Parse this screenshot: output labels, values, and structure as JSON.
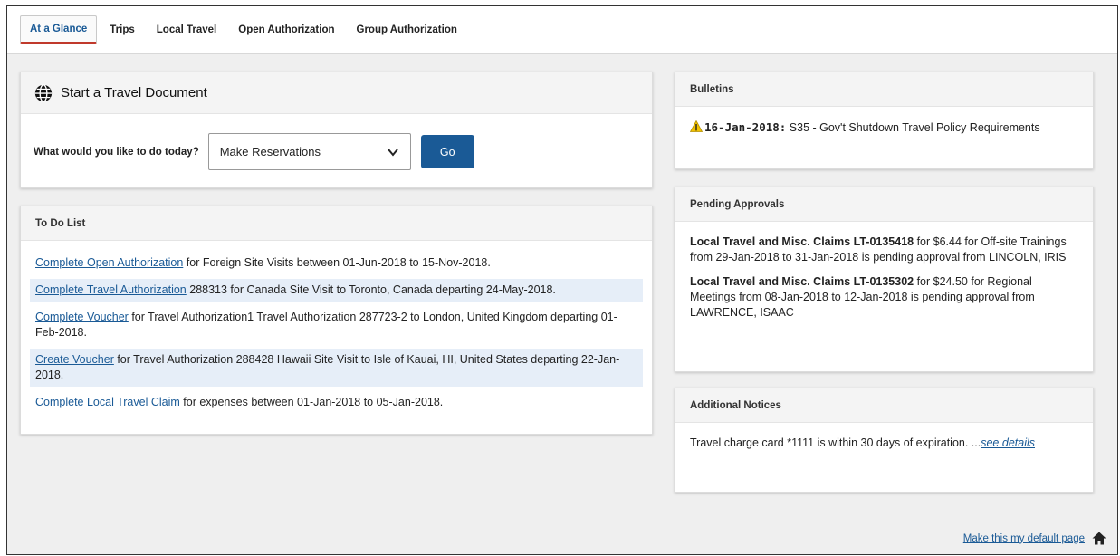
{
  "tabs": [
    "At a Glance",
    "Trips",
    "Local Travel",
    "Open Authorization",
    "Group Authorization"
  ],
  "start": {
    "title": "Start a Travel Document",
    "question": "What would you like to do today?",
    "selected": "Make Reservations",
    "go_label": "Go"
  },
  "todo": {
    "title": "To Do List",
    "items": [
      {
        "link": "Complete Open Authorization",
        "text": " for Foreign Site Visits between 01-Jun-2018 to 15-Nov-2018."
      },
      {
        "link": "Complete Travel Authorization",
        "text": " 288313 for Canada Site Visit to Toronto, Canada departing 24-May-2018."
      },
      {
        "link": "Complete Voucher",
        "text": " for Travel Authorization1 Travel Authorization 287723-2 to London, United Kingdom departing 01-Feb-2018."
      },
      {
        "link": "Create Voucher",
        "text": " for Travel Authorization 288428 Hawaii Site Visit to Isle of Kauai, HI, United States departing 22-Jan-2018."
      },
      {
        "link": "Complete Local Travel Claim",
        "text": " for expenses between 01-Jan-2018 to 05-Jan-2018."
      }
    ]
  },
  "bulletins": {
    "title": "Bulletins",
    "date": "16-Jan-2018:",
    "text": " S35 - Gov't Shutdown Travel Policy Requirements"
  },
  "approvals": {
    "title": "Pending Approvals",
    "items": [
      {
        "bold": "Local Travel and Misc. Claims LT-0135418",
        "text": " for $6.44 for Off-site Trainings from 29-Jan-2018 to 31-Jan-2018 is pending approval from LINCOLN, IRIS"
      },
      {
        "bold": "Local Travel and Misc. Claims LT-0135302",
        "text": " for $24.50 for Regional Meetings from 08-Jan-2018 to 12-Jan-2018 is pending approval from LAWRENCE, ISAAC"
      }
    ]
  },
  "notices": {
    "title": "Additional Notices",
    "text": "Travel charge card *1111 is within 30 days of expiration. ...",
    "link": "see details"
  },
  "footer": {
    "default_link": "Make this my default page"
  },
  "colors": {
    "accent": "#1a5a96",
    "active_tab_underline": "#c0392b",
    "warning": "#f2c200"
  },
  "icons": {
    "start": "globe-icon",
    "select": "chevron-down-icon",
    "bulletin": "warning-icon",
    "footer": "home-icon"
  }
}
